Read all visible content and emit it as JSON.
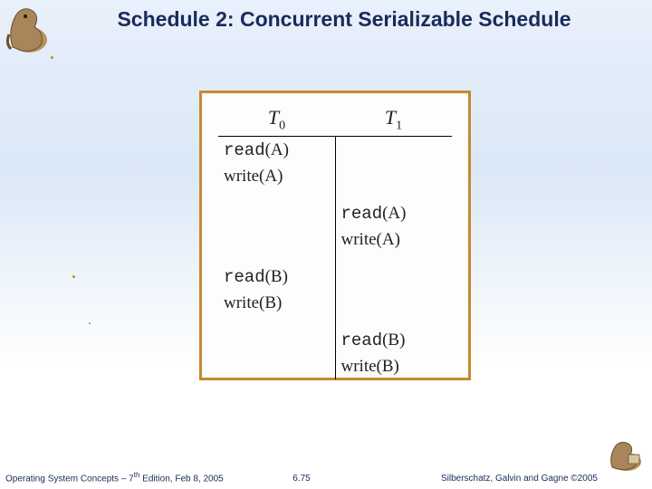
{
  "title": "Schedule 2: Concurrent Serializable Schedule",
  "schedule": {
    "headers": {
      "t0": "T",
      "t0_sub": "0",
      "t1": "T",
      "t1_sub": "1"
    },
    "rows": [
      {
        "t0_a": "read",
        "t0_b": "(A)",
        "t1_a": "",
        "t1_b": ""
      },
      {
        "t0_a": "write",
        "t0_b": "(A)",
        "t1_a": "",
        "t1_b": ""
      },
      {
        "t0_a": "",
        "t0_b": "",
        "t1_a": "read",
        "t1_b": "(A)"
      },
      {
        "t0_a": "",
        "t0_b": "",
        "t1_a": "write",
        "t1_b": "(A)"
      },
      {
        "t0_a": "read",
        "t0_b": "(B)",
        "t1_a": "",
        "t1_b": ""
      },
      {
        "t0_a": "write",
        "t0_b": "(B)",
        "t1_a": "",
        "t1_b": ""
      },
      {
        "t0_a": "",
        "t0_b": "",
        "t1_a": "read",
        "t1_b": "(B)"
      },
      {
        "t0_a": "",
        "t0_b": "",
        "t1_a": "write",
        "t1_b": "(B)"
      }
    ]
  },
  "footer": {
    "left_a": "Operating System Concepts – 7",
    "left_sup": "th",
    "left_b": " Edition, Feb 8, 2005",
    "center": "6.75",
    "right": "Silberschatz, Galvin and Gagne ©2005"
  },
  "logo": {
    "desc_tl": "dinosaur-mascot",
    "desc_br": "dinosaur-mascot-small"
  }
}
